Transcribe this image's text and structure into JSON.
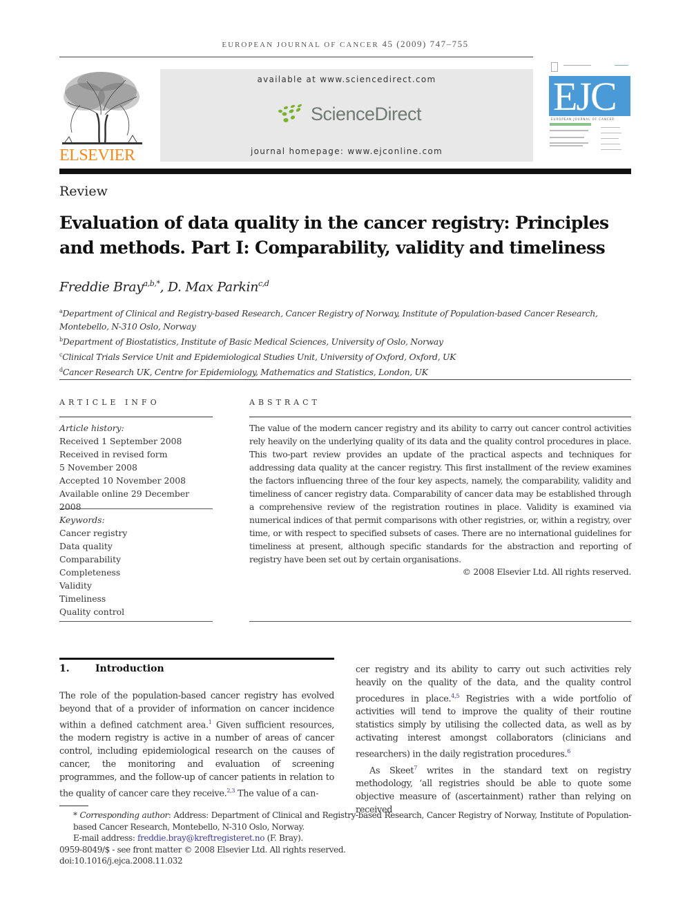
{
  "header": {
    "journal_name": "EUROPEAN JOURNAL OF CANCER",
    "journal_citation": "45 (2009) 747–755",
    "publisher_wordmark": "ELSEVIER",
    "available_at": "available at www.sciencedirect.com",
    "sciencedirect_wordmark": "ScienceDirect",
    "journal_homepage": "journal homepage: www.ejconline.com",
    "cover_title": "EJC",
    "cover_subtitle": "EUROPEAN JOURNAL OF CANCER"
  },
  "article": {
    "type": "Review",
    "title": "Evaluation of data quality in the cancer registry: Principles and methods. Part I: Comparability, validity and timeliness",
    "authors": [
      {
        "name": "Freddie Bray",
        "affil": "a,b,*"
      },
      {
        "name": "D. Max Parkin",
        "affil": "c,d"
      }
    ],
    "author_separator": ", ",
    "affiliations": [
      {
        "mark": "a",
        "text": "Department of Clinical and Registry-based Research, Cancer Registry of Norway, Institute of Population-based Cancer Research, Montebello, N-310 Oslo, Norway"
      },
      {
        "mark": "b",
        "text": "Department of Biostatistics, Institute of Basic Medical Sciences, University of Oslo, Norway"
      },
      {
        "mark": "c",
        "text": "Clinical Trials Service Unit and Epidemiological Studies Unit, University of Oxford, Oxford, UK"
      },
      {
        "mark": "d",
        "text": "Cancer Research UK, Centre for Epidemiology, Mathematics and Statistics, London, UK"
      }
    ]
  },
  "article_info": {
    "heading": "ARTICLE INFO",
    "history_label": "Article history:",
    "history": [
      "Received 1 September 2008",
      "Received in revised form",
      "5 November 2008",
      "Accepted 10 November 2008",
      "Available online 29 December 2008"
    ],
    "keywords_label": "Keywords:",
    "keywords": [
      "Cancer registry",
      "Data quality",
      "Comparability",
      "Completeness",
      "Validity",
      "Timeliness",
      "Quality control"
    ]
  },
  "abstract": {
    "heading": "ABSTRACT",
    "text": "The value of the modern cancer registry and its ability to carry out cancer control activities rely heavily on the underlying quality of its data and the quality control procedures in place. This two-part review provides an update of the practical aspects and techniques for addressing data quality at the cancer registry. This first installment of the review examines the factors influencing three of the four key aspects, namely, the comparability, validity and timeliness of cancer registry data. Comparability of cancer data may be established through a comprehensive review of the registration routines in place. Validity is examined via numerical indices of that permit comparisons with other registries, or, within a registry, over time, or with respect to specified subsets of cases. There are no international guidelines for timeliness at present, although specific standards for the abstraction and reporting of registry have been set out by certain organisations.",
    "copyright": "© 2008 Elsevier Ltd. All rights reserved."
  },
  "introduction": {
    "number": "1.",
    "heading": "Introduction",
    "left_segments": [
      {
        "t": "The role of the population-based cancer registry has evolved beyond that of a provider of information on cancer incidence within a defined catchment area."
      },
      {
        "ref": "1"
      },
      {
        "t": " Given sufficient resources, the modern registry is active in a number of areas of cancer control, including epidemiological research on the causes of cancer, the monitoring and evaluation of screening programmes, and the follow-up of cancer patients in relation to the quality of cancer care they receive."
      },
      {
        "ref": "2,3"
      },
      {
        "t": " The value of a can-"
      }
    ],
    "right_p1": [
      {
        "t": "cer registry and its ability to carry out such activities rely heavily on the quality of the data, and the quality control procedures in place."
      },
      {
        "ref": "4,5"
      },
      {
        "t": " Registries with a wide portfolio of activities will tend to improve the quality of their routine statistics simply by utilising the collected data, as well as by activating interest amongst collaborators (clinicians and researchers) in the daily registration procedures."
      },
      {
        "ref": "6"
      }
    ],
    "right_p2": [
      {
        "t": "As Skeet"
      },
      {
        "ref": "7"
      },
      {
        "t": " writes in the standard text on registry methodology, ‘all registries should be able to quote some objective measure of (ascertainment) rather than relying on received"
      }
    ]
  },
  "footnotes": {
    "star": "*",
    "corresponding_label": "Corresponding author",
    "corresponding_text": ": Address: Department of Clinical and Registry-based Research, Cancer Registry of Norway, Institute of Population-based Cancer Research, Montebello, N-310 Oslo, Norway.",
    "email_label": "E-mail address: ",
    "email": "freddie.bray@kreftregisteret.no",
    "email_suffix": " (F. Bray).",
    "issn_line": "0959-8049/$ - see front matter © 2008 Elsevier Ltd. All rights reserved.",
    "doi": "doi:10.1016/j.ejca.2008.11.032"
  },
  "colors": {
    "elsevier_orange": "#f28a1e",
    "sciencedirect_green": "#7ab22e",
    "ejc_blue": "#4a9ad8",
    "link_blue": "#3a3a9a"
  }
}
